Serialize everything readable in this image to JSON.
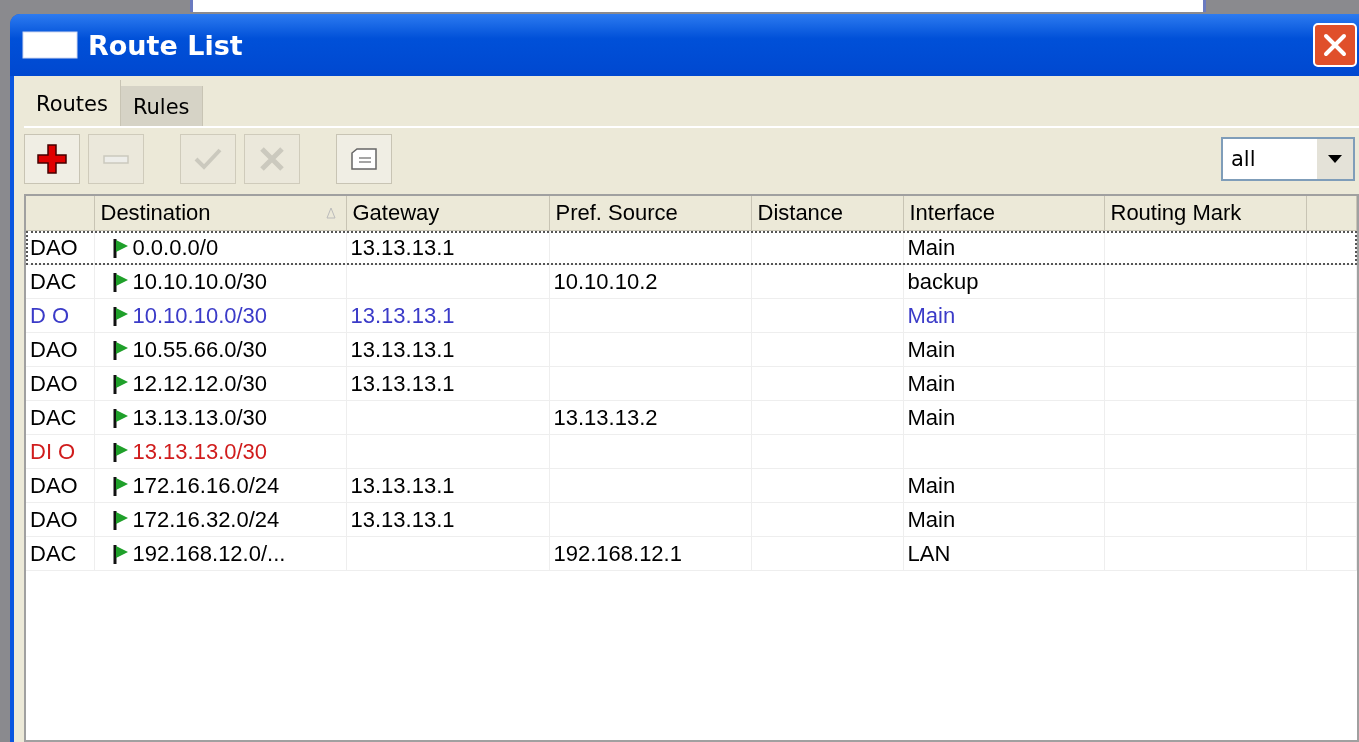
{
  "window": {
    "title": "Route List"
  },
  "tabs": [
    {
      "label": "Routes",
      "selected": true
    },
    {
      "label": "Rules",
      "selected": false
    }
  ],
  "toolbar": [
    {
      "kind": "add",
      "disabled": false
    },
    {
      "kind": "remove",
      "disabled": true
    },
    {
      "kind": "enable",
      "disabled": true
    },
    {
      "kind": "disable",
      "disabled": true
    },
    {
      "kind": "comment",
      "disabled": false
    }
  ],
  "filter": {
    "value": "all"
  },
  "table": {
    "columns": [
      {
        "label": "Destination",
        "sorted": true
      },
      {
        "label": "Gateway",
        "sorted": false
      },
      {
        "label": "Pref. Source",
        "sorted": false
      },
      {
        "label": "Distance",
        "sorted": false
      },
      {
        "label": "Interface",
        "sorted": false
      },
      {
        "label": "Routing Mark",
        "sorted": false
      }
    ],
    "rows": [
      {
        "flags": "DAO",
        "destination": "0.0.0.0/0",
        "gateway": "13.13.13.1",
        "interface": "Main",
        "color": "#000000",
        "selected": true
      },
      {
        "flags": "DAC",
        "destination": "10.10.10.0/30",
        "pref_source": "10.10.10.2",
        "interface": "backup",
        "color": "#000000",
        "selected": false
      },
      {
        "flags": "D O",
        "destination": "10.10.10.0/30",
        "gateway": "13.13.13.1",
        "interface": "Main",
        "color": "#3b3bc8",
        "selected": false
      },
      {
        "flags": "DAO",
        "destination": "10.55.66.0/30",
        "gateway": "13.13.13.1",
        "interface": "Main",
        "color": "#000000",
        "selected": false
      },
      {
        "flags": "DAO",
        "destination": "12.12.12.0/30",
        "gateway": "13.13.13.1",
        "interface": "Main",
        "color": "#000000",
        "selected": false
      },
      {
        "flags": "DAC",
        "destination": "13.13.13.0/30",
        "pref_source": "13.13.13.2",
        "interface": "Main",
        "color": "#000000",
        "selected": false
      },
      {
        "flags": "DI O",
        "destination": "13.13.13.0/30",
        "color": "#d01c1c",
        "selected": false
      },
      {
        "flags": "DAO",
        "destination": "172.16.16.0/24",
        "gateway": "13.13.13.1",
        "interface": "Main",
        "color": "#000000",
        "selected": false
      },
      {
        "flags": "DAO",
        "destination": "172.16.32.0/24",
        "gateway": "13.13.13.1",
        "interface": "Main",
        "color": "#000000",
        "selected": false
      },
      {
        "flags": "DAC",
        "destination": "192.168.12.0/...",
        "pref_source": "192.168.12.1",
        "interface": "LAN",
        "color": "#000000",
        "selected": false
      }
    ]
  }
}
